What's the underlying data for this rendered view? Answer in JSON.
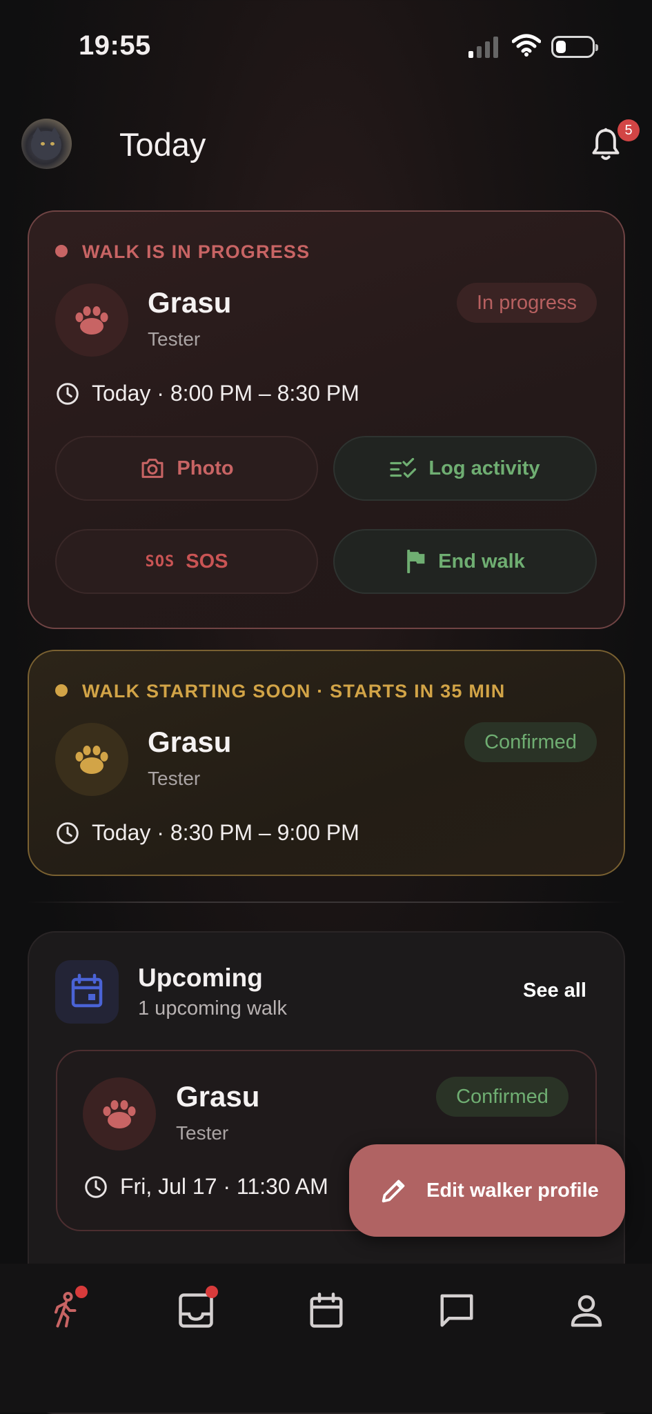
{
  "status_bar": {
    "time": "19:55"
  },
  "header": {
    "title": "Today",
    "notification_count": "5"
  },
  "active_walk": {
    "section_label": "WALK IS IN PROGRESS",
    "pet_name": "Grasu",
    "pet_subtitle": "Tester",
    "status_pill": "In progress",
    "time": "Today · 8:00 PM – 8:30 PM",
    "actions": {
      "photo": "Photo",
      "log_activity": "Log activity",
      "sos_icon_text": "SOS",
      "sos": "SOS",
      "end_walk": "End walk"
    }
  },
  "soon_walk": {
    "section_label": "WALK STARTING SOON · STARTS IN 35 MIN",
    "pet_name": "Grasu",
    "pet_subtitle": "Tester",
    "status_pill": "Confirmed",
    "time": "Today · 8:30 PM – 9:00 PM"
  },
  "upcoming": {
    "title": "Upcoming",
    "subtitle": "1 upcoming walk",
    "see_all": "See all",
    "items": [
      {
        "pet_name": "Grasu",
        "pet_subtitle": "Tester",
        "status_pill": "Confirmed",
        "time": "Fri, Jul 17 · 11:30 AM"
      }
    ]
  },
  "fab": {
    "label": "Edit walker profile"
  },
  "bottom_nav": {
    "items": [
      {
        "icon": "walk-icon",
        "active": true,
        "dot": true
      },
      {
        "icon": "inbox-icon",
        "active": false,
        "dot": true
      },
      {
        "icon": "calendar-icon",
        "active": false,
        "dot": false
      },
      {
        "icon": "chat-icon",
        "active": false,
        "dot": false
      },
      {
        "icon": "profile-icon",
        "active": false,
        "dot": false
      }
    ]
  },
  "colors": {
    "accent_red": "#c86464",
    "accent_green": "#6fae72",
    "accent_gold": "#d2a447",
    "badge_red": "#d24545",
    "fab": "#b06363"
  }
}
